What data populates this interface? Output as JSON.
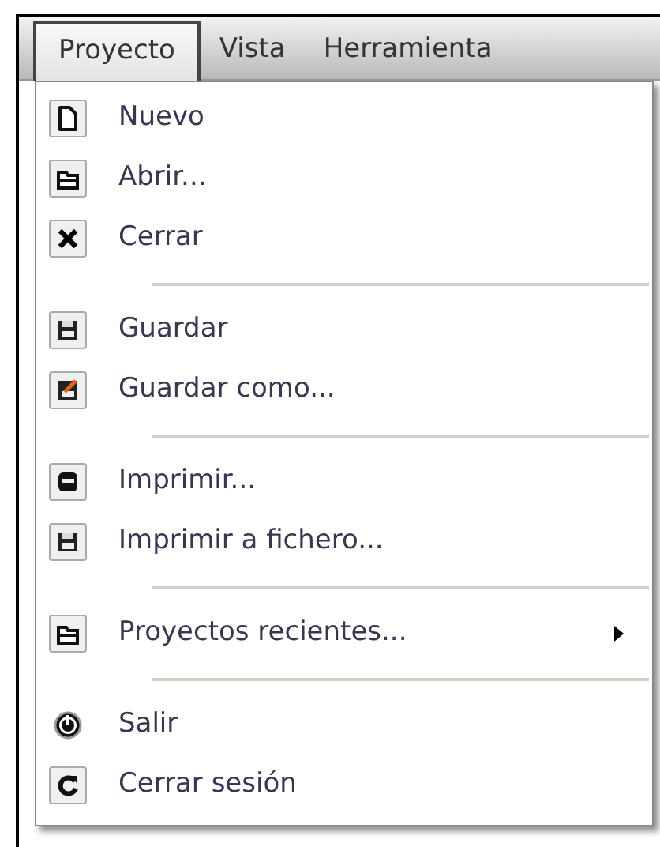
{
  "menubar": [
    {
      "label": "Proyecto",
      "selected": true
    },
    {
      "label": "Vista",
      "selected": false
    },
    {
      "label": "Herramienta",
      "selected": false
    }
  ],
  "menu": [
    {
      "kind": "item",
      "label": "Nuevo",
      "submenu": false
    },
    {
      "kind": "item",
      "label": "Abrir...",
      "submenu": false
    },
    {
      "kind": "item",
      "label": "Cerrar",
      "submenu": false
    },
    {
      "kind": "separator"
    },
    {
      "kind": "item",
      "label": "Guardar",
      "submenu": false
    },
    {
      "kind": "item",
      "label": "Guardar como...",
      "submenu": false
    },
    {
      "kind": "separator"
    },
    {
      "kind": "item",
      "label": "Imprimir...",
      "submenu": false
    },
    {
      "kind": "item",
      "label": "Imprimir a fichero...",
      "submenu": false
    },
    {
      "kind": "separator"
    },
    {
      "kind": "item",
      "label": "Proyectos recientes...",
      "submenu": true
    },
    {
      "kind": "separator"
    },
    {
      "kind": "item",
      "label": "Salir",
      "submenu": false
    },
    {
      "kind": "item",
      "label": "Cerrar sesión",
      "submenu": false
    }
  ]
}
